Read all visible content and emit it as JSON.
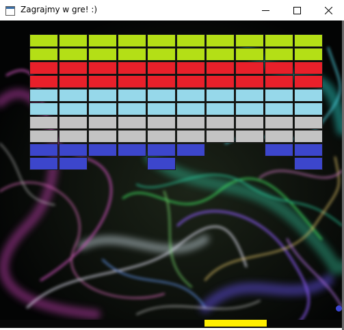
{
  "window": {
    "title": "Zagrajmy w gre! :)"
  },
  "icons": {
    "app": "window-app-icon",
    "minimize": "minimize-icon",
    "maximize": "maximize-icon",
    "close": "close-icon"
  },
  "colors": {
    "rows": [
      "#b4df16",
      "#b4df16",
      "#e8202a",
      "#e8202a",
      "#96d8ea",
      "#96d8ea",
      "#c3c3c3",
      "#c3c3c3",
      "#3c46cc",
      "#3c46cc"
    ],
    "paddle": "#ffef00",
    "ball": "#3c46d2"
  },
  "bricks": [
    [
      1,
      1,
      1,
      1,
      1,
      1,
      1,
      1,
      1,
      1
    ],
    [
      1,
      1,
      1,
      1,
      1,
      1,
      1,
      1,
      1,
      1
    ],
    [
      1,
      1,
      1,
      1,
      1,
      1,
      1,
      1,
      1,
      1
    ],
    [
      1,
      1,
      1,
      1,
      1,
      1,
      1,
      1,
      1,
      1
    ],
    [
      1,
      1,
      1,
      1,
      1,
      1,
      1,
      1,
      1,
      1
    ],
    [
      1,
      1,
      1,
      1,
      1,
      1,
      1,
      1,
      1,
      1
    ],
    [
      1,
      1,
      1,
      1,
      1,
      1,
      1,
      1,
      1,
      1
    ],
    [
      1,
      1,
      1,
      1,
      1,
      1,
      1,
      1,
      1,
      1
    ],
    [
      1,
      1,
      1,
      1,
      1,
      1,
      0,
      0,
      1,
      1
    ],
    [
      1,
      1,
      0,
      0,
      1,
      0,
      0,
      0,
      0,
      1
    ]
  ]
}
